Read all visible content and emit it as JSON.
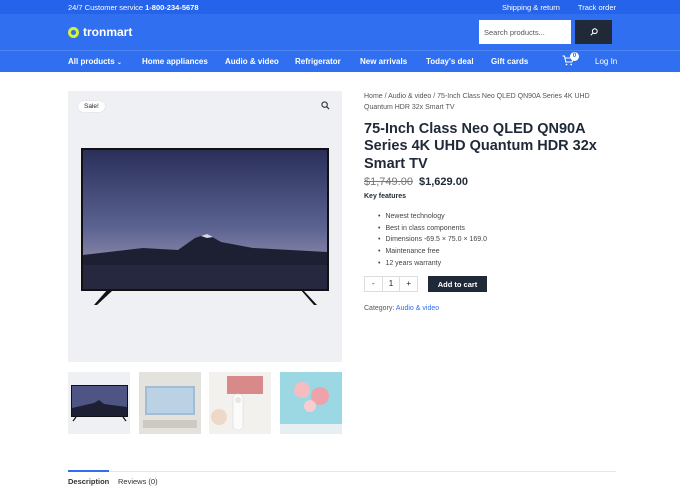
{
  "topbar": {
    "service_label": "24/7 Customer service",
    "phone": "1-800-234-5678",
    "links": [
      "Shipping & return",
      "Track order"
    ]
  },
  "header": {
    "logo": "tronmart",
    "search_placeholder": "Search products..."
  },
  "nav": {
    "items": [
      "All products",
      "Home appliances",
      "Audio & video",
      "Refrigerator",
      "New arrivals",
      "Today's deal",
      "Gift cards"
    ],
    "cart_count": "0",
    "login": "Log In"
  },
  "product": {
    "sale_badge": "Sale!",
    "breadcrumb": "Home / Audio & video / 75-Inch Class Neo QLED QN90A Series 4K UHD Quantum HDR 32x Smart TV",
    "title": "75-Inch Class Neo QLED QN90A Series 4K UHD Quantum HDR 32x Smart TV",
    "old_price": "$1,749.00",
    "new_price": "$1,629.00",
    "features_heading": "Key features",
    "features": [
      "Newest technology",
      "Best in class components",
      "Dimensions -69.5 × 75.0 × 169.0",
      "Maintenance free",
      "12 years warranty"
    ],
    "qty_minus": "-",
    "qty_value": "1",
    "qty_plus": "+",
    "add_to_cart": "Add to cart",
    "category_label": "Category:",
    "category_value": "Audio & video"
  },
  "tabs": [
    "Description",
    "Reviews (0)"
  ],
  "colors": {
    "primary": "#2f6ff0",
    "dark": "#1f2937",
    "accent": "#d4f03a"
  }
}
